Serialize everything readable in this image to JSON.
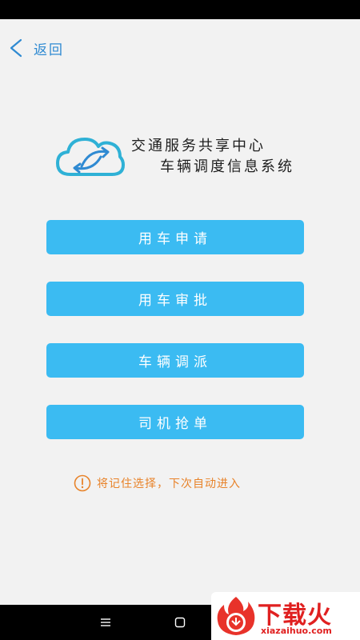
{
  "header": {
    "back_label": "返回"
  },
  "brand": {
    "title_line_1": "交通服务共享中心",
    "title_line_2": "车辆调度信息系统",
    "logo_icon": "cloud-exchange-icon"
  },
  "menu": [
    {
      "label": "用车申请"
    },
    {
      "label": "用车审批"
    },
    {
      "label": "车辆调派"
    },
    {
      "label": "司机抢单"
    }
  ],
  "remember": {
    "label": "将记住选择，下次自动进入",
    "icon": "alert-circle-icon"
  },
  "watermark": {
    "main": "下载火",
    "sub": "xiazaihuo.com"
  },
  "colors": {
    "accent": "#3bbbf2",
    "back": "#2f8ad2",
    "warning": "#e8832a",
    "watermark": "#e02020"
  }
}
